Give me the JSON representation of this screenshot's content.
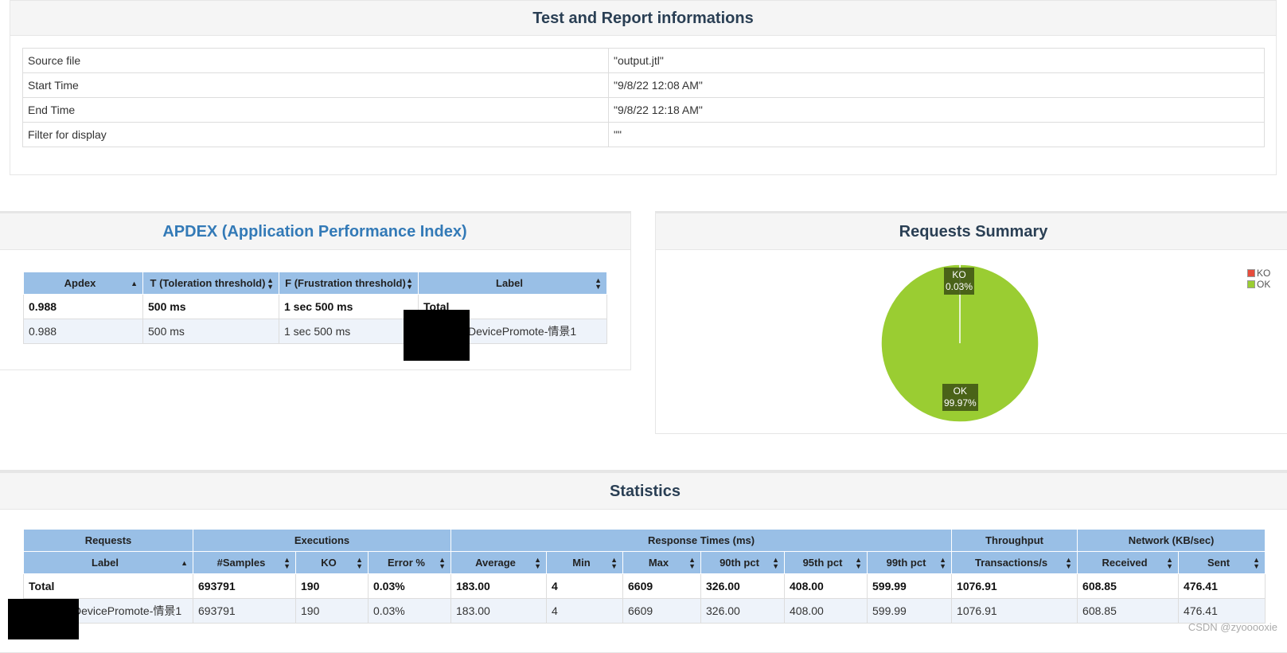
{
  "info_panel": {
    "title": "Test and Report informations",
    "rows": [
      {
        "key": "Source file",
        "value": "\"output.jtl\""
      },
      {
        "key": "Start Time",
        "value": "\"9/8/22 12:08 AM\""
      },
      {
        "key": "End Time",
        "value": "\"9/8/22 12:18 AM\""
      },
      {
        "key": "Filter for display",
        "value": "\"\""
      }
    ]
  },
  "apdex_panel": {
    "title": "APDEX (Application Performance Index)",
    "headers": [
      "Apdex",
      "T (Toleration threshold)",
      "F (Frustration threshold)",
      "Label"
    ],
    "rows": [
      {
        "apdex": "0.988",
        "t": "500 ms",
        "f": "1 sec 500 ms",
        "label": "Total"
      },
      {
        "apdex": "0.988",
        "t": "500 ms",
        "f": "1 sec 500 ms",
        "label": "DevicePromote-情景1"
      }
    ]
  },
  "summary_panel": {
    "title": "Requests Summary",
    "legend": [
      {
        "name": "KO",
        "color": "#e74c3c"
      },
      {
        "name": "OK",
        "color": "#9acd32"
      }
    ]
  },
  "chart_data": {
    "type": "pie",
    "slices": [
      {
        "name": "KO",
        "label": "KO",
        "percent_label": "0.03%",
        "value": 0.03,
        "color": "#e74c3c"
      },
      {
        "name": "OK",
        "label": "OK",
        "percent_label": "99.97%",
        "value": 99.97,
        "color": "#9acd32"
      }
    ]
  },
  "stats_panel": {
    "title": "Statistics",
    "group_headers": [
      "Requests",
      "Executions",
      "Response Times (ms)",
      "Throughput",
      "Network (KB/sec)"
    ],
    "headers": [
      "Label",
      "#Samples",
      "KO",
      "Error %",
      "Average",
      "Min",
      "Max",
      "90th pct",
      "95th pct",
      "99th pct",
      "Transactions/s",
      "Received",
      "Sent"
    ],
    "rows": [
      [
        "Total",
        "693791",
        "190",
        "0.03%",
        "183.00",
        "4",
        "6609",
        "326.00",
        "408.00",
        "599.99",
        "1076.91",
        "608.85",
        "476.41"
      ],
      [
        "DevicePromote-情景1",
        "693791",
        "190",
        "0.03%",
        "183.00",
        "4",
        "6609",
        "326.00",
        "408.00",
        "599.99",
        "1076.91",
        "608.85",
        "476.41"
      ]
    ]
  },
  "watermark": "CSDN @zyooooxie"
}
